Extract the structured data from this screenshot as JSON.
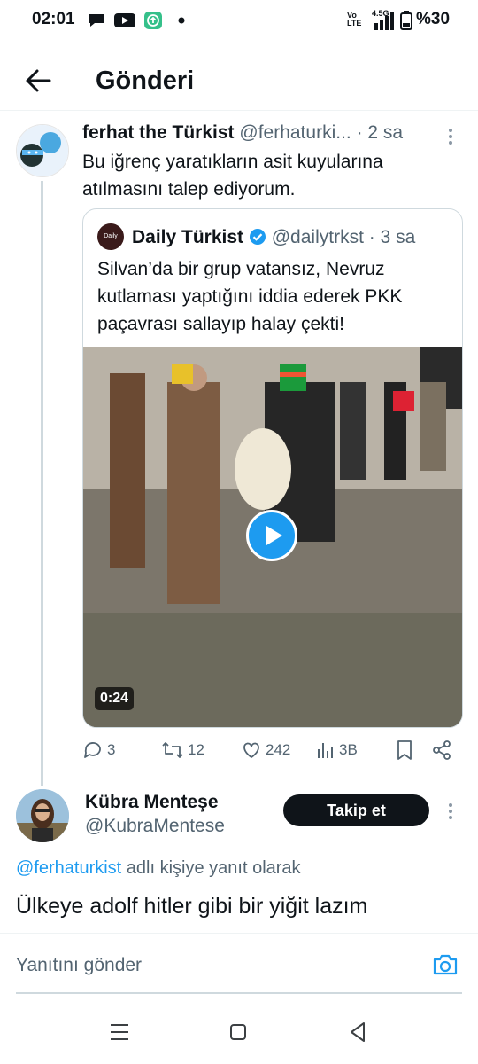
{
  "status_bar": {
    "time": "02:01",
    "network": "4.5G",
    "volte": "Vo LTE",
    "battery": "%30"
  },
  "header": {
    "title": "Gönderi"
  },
  "post": {
    "author_name": "ferhat the Türkist",
    "author_handle": "@ferhaturki...",
    "separator": "·",
    "time": "2 sa",
    "text_line1": "Bu iğrenç yaratıkların asit kuyularına",
    "text_line2": "atılmasını talep ediyorum.",
    "quote": {
      "author_name": "Daily Türkist",
      "author_handle": "@dailytrkst",
      "separator": "·",
      "time": "3 sa",
      "logo_text": "Daily Türkist",
      "text_line1": "Silvan’da bir grup vatansız, Nevruz",
      "text_line2": "kutlaması yaptığını iddia ederek PKK",
      "text_line3": "paçavrası sallayıp halay çekti!",
      "video_duration": "0:24"
    },
    "actions": {
      "replies": "3",
      "reposts": "12",
      "likes": "242",
      "views": "3B"
    }
  },
  "reply": {
    "author_name": "Kübra Menteşe",
    "author_handle": "@KubraMentese",
    "follow_label": "Takip et",
    "mention": "@ferhaturkist",
    "replying_suffix": "adlı kişiye yanıt olarak",
    "text": "Ülkeye adolf hitler gibi bir yiğit lazım"
  },
  "composer": {
    "placeholder": "Yanıtını gönder"
  },
  "colors": {
    "accent": "#1d9bf0",
    "text": "#0f1419",
    "secondary": "#536471",
    "border": "#cfd9de",
    "verified": "#1d9bf0"
  },
  "icons": [
    "back-arrow-icon",
    "more-icon",
    "verified-icon",
    "play-icon",
    "reply-icon",
    "repost-icon",
    "like-icon",
    "views-icon",
    "bookmark-icon",
    "share-icon",
    "camera-icon",
    "menu-nav-icon",
    "home-nav-icon",
    "back-nav-icon"
  ]
}
